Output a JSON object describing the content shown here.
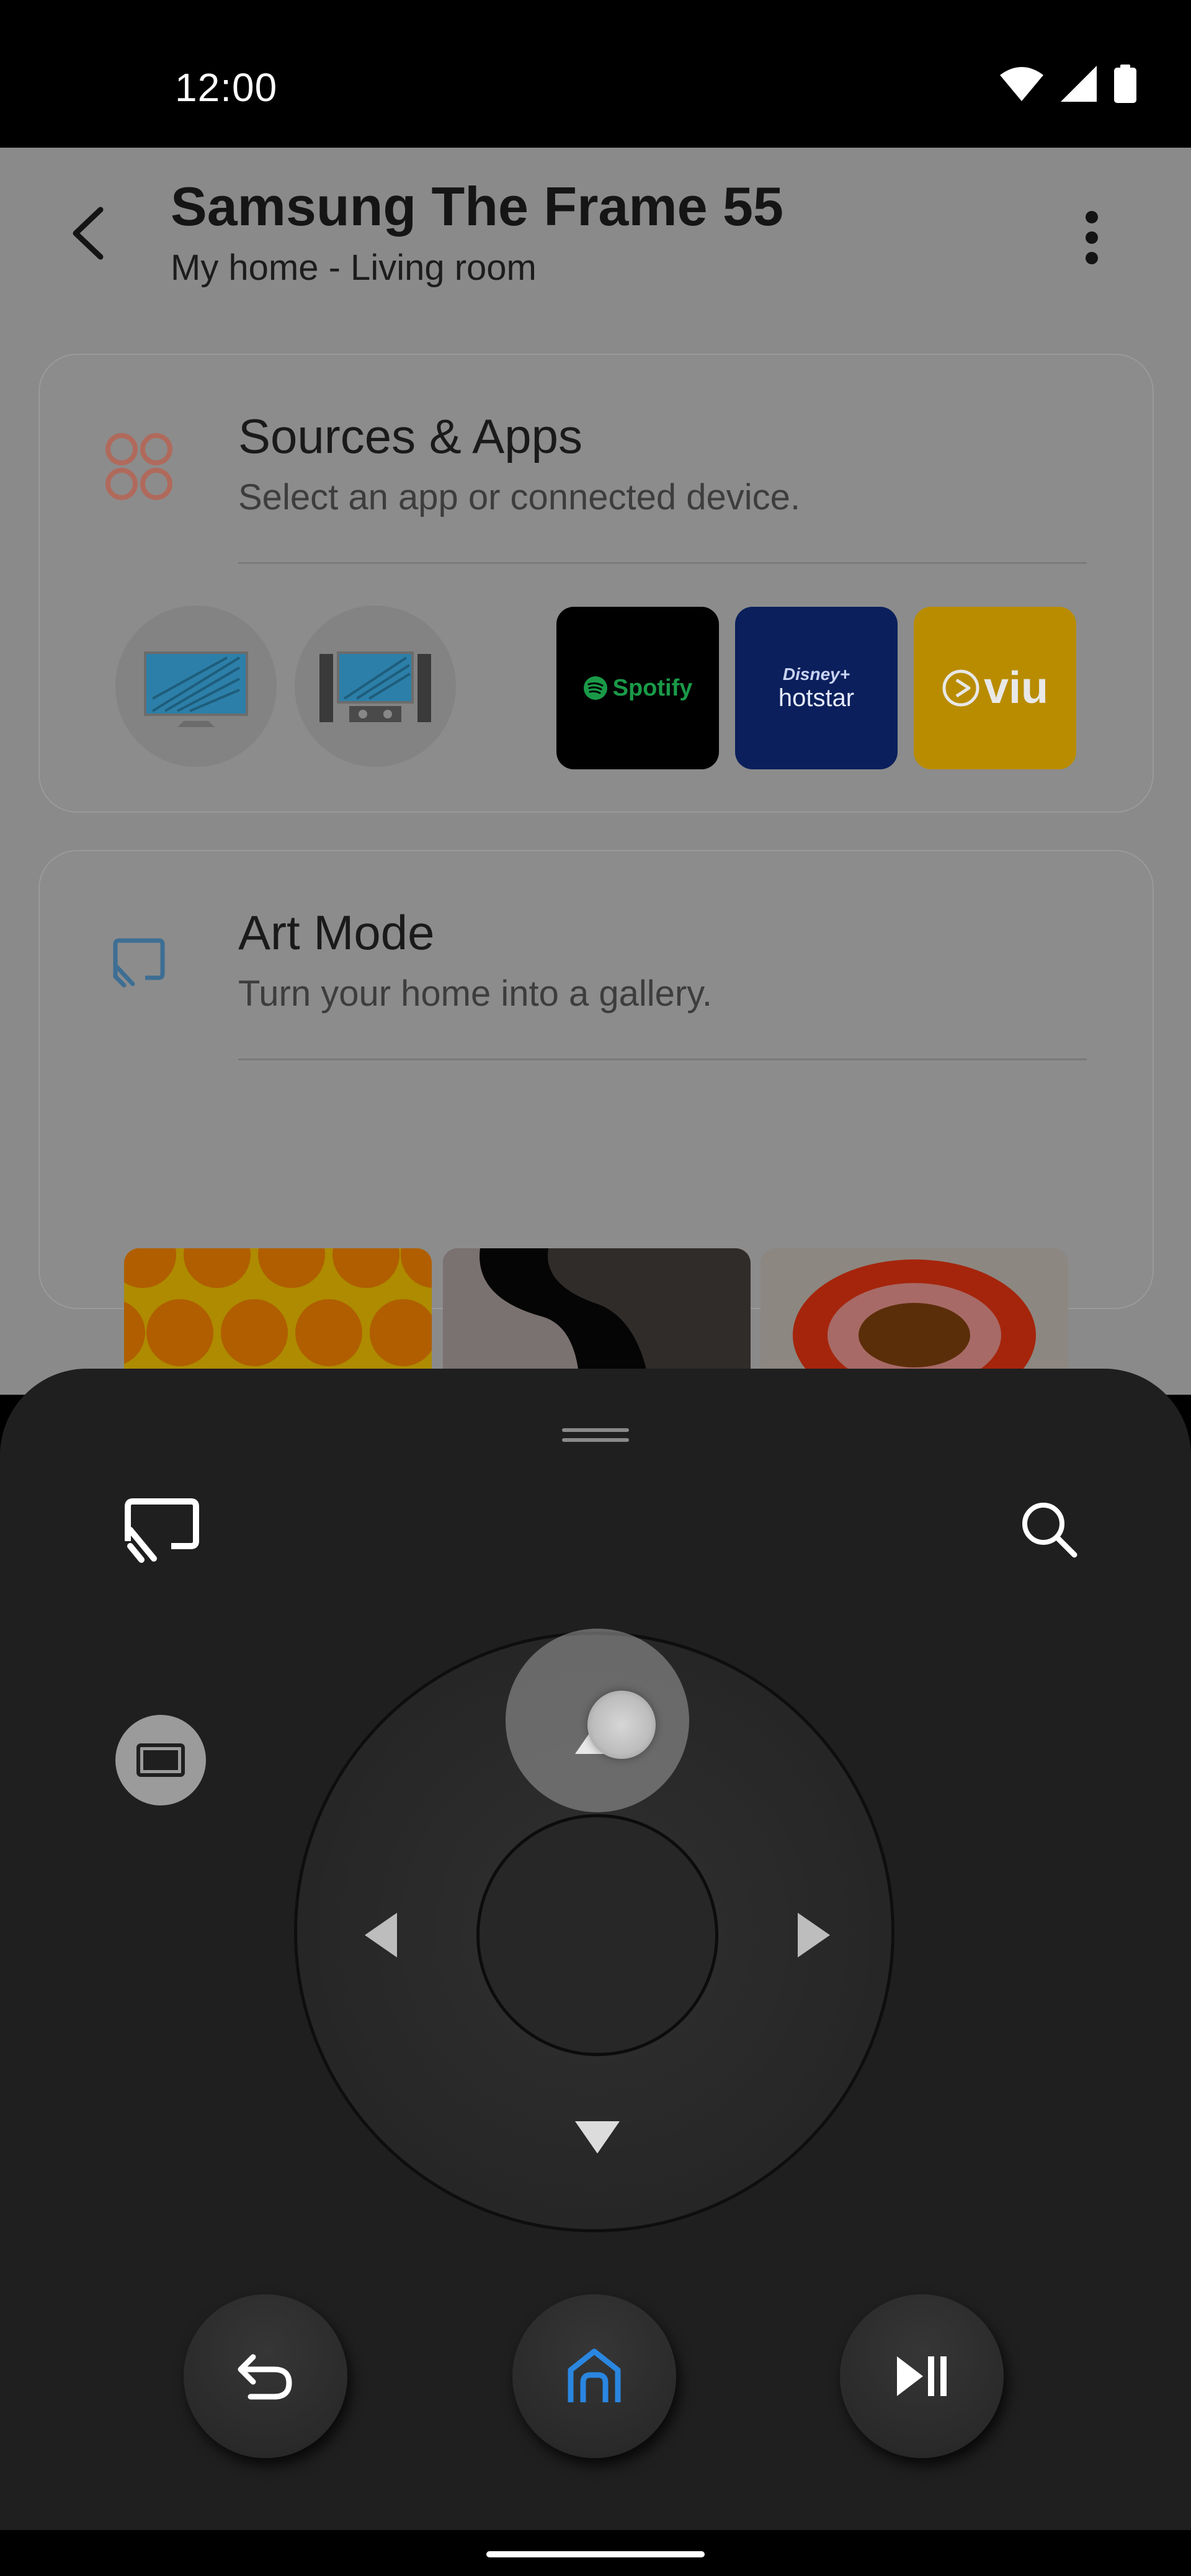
{
  "status_bar": {
    "time": "12:00",
    "icons": [
      "wifi-icon",
      "cellular-signal-icon",
      "battery-icon"
    ]
  },
  "header": {
    "title": "Samsung The Frame 55",
    "subtitle": "My home - Living room",
    "back_icon": "chevron-left-icon",
    "more_icon": "more-vertical-icon"
  },
  "sources_card": {
    "title": "Sources & Apps",
    "subtitle": "Select an app or connected device.",
    "icon": "apps-grid-icon",
    "devices": [
      "tv-device-icon",
      "home-theater-device-icon"
    ],
    "apps": [
      {
        "name": "Spotify",
        "label": "Spotify",
        "color": "#000000"
      },
      {
        "name": "Disney+ Hotstar",
        "label_top": "Disney+",
        "label_bottom": "hotstar",
        "color": "#0b1f5c"
      },
      {
        "name": "Viu",
        "label": "viu",
        "color": "#b98c00"
      }
    ]
  },
  "art_card": {
    "title": "Art Mode",
    "subtitle": "Turn your home into a gallery.",
    "icon": "cast-screen-icon",
    "artworks": [
      "art-orange-circles",
      "art-black-wave",
      "art-red-oval"
    ]
  },
  "remote": {
    "icons": {
      "cast": "cast-screen-icon",
      "search": "search-icon",
      "aspect": "screen-ratio-icon",
      "back": "return-arrow-icon",
      "home": "home-icon",
      "play_pause": "play-pause-icon"
    },
    "accent_color": "#2a86e0"
  },
  "colors": {
    "sheet_background": "#1f1f1f",
    "scrim": "#8a8a8a"
  }
}
